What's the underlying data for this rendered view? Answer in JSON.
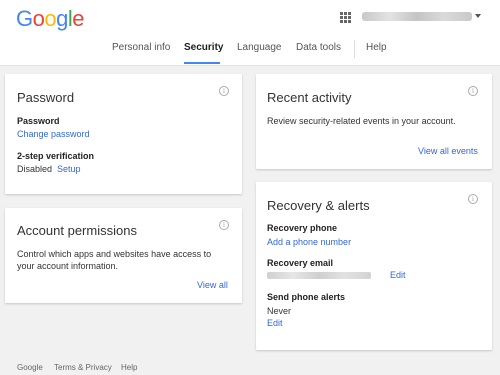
{
  "header": {
    "logo_letters": [
      {
        "char": "G",
        "color": "#4285f4"
      },
      {
        "char": "o",
        "color": "#ea4335"
      },
      {
        "char": "o",
        "color": "#fbbc05"
      },
      {
        "char": "g",
        "color": "#4285f4"
      },
      {
        "char": "l",
        "color": "#34a853"
      },
      {
        "char": "e",
        "color": "#ea4335"
      }
    ],
    "apps_icon": "apps-grid-icon",
    "account_caret_icon": "caret-down-icon"
  },
  "nav": {
    "items": [
      "Personal info",
      "Security",
      "Language",
      "Data tools",
      "Help"
    ],
    "active": "Security"
  },
  "password_card": {
    "title": "Password",
    "password_label": "Password",
    "change_password": "Change password",
    "two_step_label": "2-step verification",
    "two_step_status": "Disabled",
    "setup": "Setup"
  },
  "permissions_card": {
    "title": "Account permissions",
    "description_line1": "Control which apps and websites have access to",
    "description_line2": "your account information.",
    "view_all": "View all"
  },
  "activity_card": {
    "title": "Recent activity",
    "description": "Review security-related events in your account.",
    "view_all_events": "View all events"
  },
  "recovery_card": {
    "title": "Recovery & alerts",
    "phone_label": "Recovery phone",
    "add_phone": "Add a phone number",
    "email_label": "Recovery email",
    "email_edit": "Edit",
    "alerts_label": "Send phone alerts",
    "alerts_value": "Never",
    "alerts_edit": "Edit"
  },
  "footer": {
    "items": [
      "Google",
      "Terms & Privacy",
      "Help"
    ]
  },
  "colors": {
    "accent": "#4285f4",
    "link": "#3367d6",
    "background": "#f1f1f1"
  }
}
